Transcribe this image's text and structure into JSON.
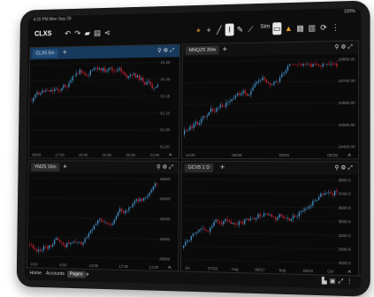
{
  "status": {
    "time": "4:20 PM  Mon Sep 29",
    "battery": "100%"
  },
  "app": {
    "title": "CLXS"
  },
  "toolbar": {
    "sim_label": "Sim"
  },
  "charts": [
    {
      "tab_label": "CLX5 5m",
      "active": true,
      "y_ticks": [
        "61.25",
        "61.20",
        "61.15",
        "61.10",
        "61.05",
        "61.00"
      ],
      "x_ticks": [
        "09/26",
        "17:00",
        "18:00",
        "19:00",
        "20:00",
        "21:00"
      ],
      "seed": 11,
      "trend": "updown"
    },
    {
      "tab_label": "MNQZ5 30m",
      "active": false,
      "y_ticks": [
        "24800.00",
        "24700.00",
        "24600.00",
        "24500.00",
        "24400.00"
      ],
      "x_ticks": [
        "14:00",
        "09/26",
        "09/26",
        "09/29"
      ],
      "seed": 23,
      "trend": "up"
    },
    {
      "tab_label": "YMZ5 15m",
      "active": false,
      "y_ticks": [
        "46600",
        "46400",
        "46200",
        "46000",
        "45800"
      ],
      "x_ticks": [
        "0:00",
        "9:00",
        "13:00",
        "17:00",
        "21:00"
      ],
      "seed": 37,
      "trend": "up"
    },
    {
      "tab_label": "GCV5 1 D",
      "active": false,
      "y_ticks": [
        "3800.0",
        "3700.0",
        "3600.0",
        "3500.0",
        "3400.0",
        "3300.0",
        "3200.0"
      ],
      "x_ticks": [
        "Jul",
        "07/20",
        "Aug",
        "08/17",
        "Sep",
        "09/16",
        "Oct"
      ],
      "seed": 53,
      "trend": "up"
    }
  ],
  "bottom_tabs": [
    "Home",
    "Accounts",
    "Pages"
  ]
}
